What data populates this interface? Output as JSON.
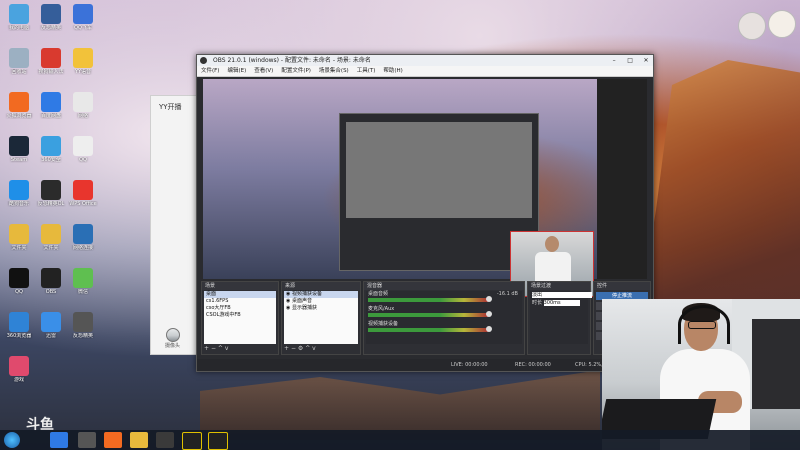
{
  "desktop": {
    "icons": [
      {
        "label": "我的电脑",
        "color": "#4aa3df"
      },
      {
        "label": "反恐精英",
        "color": "#355e9a"
      },
      {
        "label": "QQ飞车",
        "color": "#3b72d9"
      },
      {
        "label": "回收站",
        "color": "#9cb0c2"
      },
      {
        "label": "搜狗输入法",
        "color": "#d93a2f"
      },
      {
        "label": "YY语音",
        "color": "#f2c23a"
      },
      {
        "label": "火狐浏览器",
        "color": "#f26a21"
      },
      {
        "label": "百度网盘",
        "color": "#2f7ae5"
      },
      {
        "label": "网络",
        "color": "#e8e8e8"
      },
      {
        "label": "Steam",
        "color": "#1b2838"
      },
      {
        "label": "360安全",
        "color": "#3aa0e0"
      },
      {
        "label": "QQ",
        "color": "#eeeeee"
      },
      {
        "label": "酷狗音乐",
        "color": "#1f8fe8"
      },
      {
        "label": "反恐精英OL",
        "color": "#2b2b2b"
      },
      {
        "label": "WPS Office",
        "color": "#e8352d"
      },
      {
        "label": "文件夹",
        "color": "#e7b93c"
      },
      {
        "label": "文件夹",
        "color": "#e7b93c"
      },
      {
        "label": "网络连接",
        "color": "#2a6fb5"
      },
      {
        "label": "QQ",
        "color": "#111111"
      },
      {
        "label": "OBS",
        "color": "#222222"
      },
      {
        "label": "微信",
        "color": "#5fbf50"
      },
      {
        "label": "360浏览器",
        "color": "#2f83d6"
      },
      {
        "label": "迅雷",
        "color": "#3a8fe8"
      },
      {
        "label": "反恐精英",
        "color": "#555555"
      },
      {
        "label": "游戏",
        "color": "#e04a6d"
      }
    ],
    "watermark": "斗鱼"
  },
  "yy_panel": {
    "title": "YY开播",
    "camera_label": "摄像头"
  },
  "obs": {
    "title": "OBS 21.0.1 (windows) - 配置文件: 未命名 - 场景: 未命名",
    "menu": [
      "文件(F)",
      "编辑(E)",
      "查看(V)",
      "配置文件(P)",
      "场景集合(S)",
      "工具(T)",
      "帮助(H)"
    ],
    "scenes_header": "场景",
    "scenes": [
      "桌面",
      "cs1.6FPS",
      "cso大厅FB",
      "CSOL游戏中FB"
    ],
    "sources_header": "来源",
    "sources": [
      "视频捕获设备",
      "桌面声音",
      "显示器捕获"
    ],
    "mixer_header": "混音器",
    "mixer": [
      {
        "name": "桌面音频",
        "db": "-16.1 dB"
      },
      {
        "name": "麦克风/Aux",
        "db": ""
      },
      {
        "name": "视频捕获设备",
        "db": ""
      }
    ],
    "transitions_header": "场景过渡",
    "transition_value": "淡出",
    "duration_label": "时长",
    "duration_value": "300ms",
    "controls_header": "控件",
    "controls": [
      "停止推流",
      "开始录制",
      "工作室模式",
      "设置",
      "退出"
    ],
    "status": {
      "live": "LIVE: 00:00:00",
      "rec": "REC: 00:00:00",
      "cpu": "CPU: 5.2%, 30.00 fps"
    }
  },
  "webcam": {
    "watermark": "斗鱼"
  }
}
